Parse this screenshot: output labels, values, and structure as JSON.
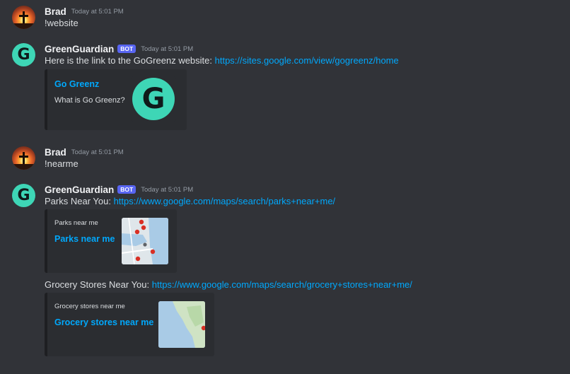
{
  "messages": [
    {
      "username": "Brad",
      "timestamp": "Today at 5:01 PM",
      "text": "!website"
    },
    {
      "username": "GreenGuardian",
      "bot_tag": "BOT",
      "timestamp": "Today at 5:01 PM",
      "text_prefix": "Here is the link to the GoGreenz website: ",
      "link": "https://sites.google.com/view/gogreenz/home",
      "embed": {
        "title": "Go Greenz",
        "description": "What is Go Greenz?"
      }
    },
    {
      "username": "Brad",
      "timestamp": "Today at 5:01 PM",
      "text": "!nearme"
    },
    {
      "username": "GreenGuardian",
      "bot_tag": "BOT",
      "timestamp": "Today at 5:01 PM",
      "parks_prefix": "Parks Near You: ",
      "parks_link": "https://www.google.com/maps/search/parks+near+me/",
      "parks_embed": {
        "provider": "Parks near me",
        "title": "Parks near me"
      },
      "grocery_prefix": "Grocery Stores Near You: ",
      "grocery_link": "https://www.google.com/maps/search/grocery+stores+near+me/",
      "grocery_embed": {
        "provider": "Grocery stores near me",
        "title": "Grocery stores near me"
      }
    }
  ],
  "avatar_letter": "G",
  "colors": {
    "background": "#313338",
    "link": "#00a8fc",
    "embed_bg": "#2b2d31",
    "bot_tag": "#5865f2",
    "avatar_teal": "#3ed6b6"
  },
  "icons": {
    "brad_avatar": "sunset-cross-avatar",
    "bot_avatar": "gogreenz-logo",
    "map_pin": "map-pin-icon"
  }
}
